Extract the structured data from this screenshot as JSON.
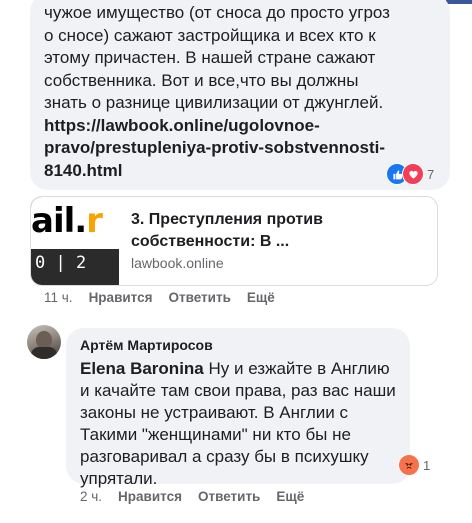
{
  "comment1": {
    "text": "чужое имущество (от сноса до просто угроз о сносе) сажают застройщика и всех кто к этому причастен. В нашей стране сажают собственника. Вот и все,что вы должны знать о разнице цивилизации от джунглей.",
    "link": "https://lawbook.online/ugolovnoe-pravo/prestupleniya-protiv-sobstvennosti-8140.html",
    "reaction_count": "7",
    "reactions": [
      "like-icon",
      "love-icon"
    ]
  },
  "link_preview": {
    "thumb_logo_left": "ail.",
    "thumb_logo_accent": "r",
    "thumb_bottom": "0 | 2",
    "title": "3. Преступления против собственности: В ...",
    "domain": "lawbook.online"
  },
  "comment1_actions": {
    "time": "11 ч.",
    "like": "Нравится",
    "reply": "Ответить",
    "more": "Ещё"
  },
  "comment2": {
    "author": "Артём Мартиросов",
    "mention": "Elena Baronina",
    "text": " Ну и езжайте в Англию и качайте там свои права, раз вас наши законы не устраивают. В Англии с Такими \"женщинами\" ни кто бы не разговаривал а сразу бы в психушку упрятали.",
    "reaction_count": "1",
    "reactions": [
      "angry-icon"
    ]
  },
  "comment2_actions": {
    "time": "2 ч.",
    "like": "Нравится",
    "reply": "Ответить",
    "more": "Ещё"
  },
  "colors": {
    "bubble": "#f0f2f5",
    "meta": "#65676b",
    "like": "#1877f2",
    "love": "#f33e58",
    "angry": "#f7714c"
  }
}
